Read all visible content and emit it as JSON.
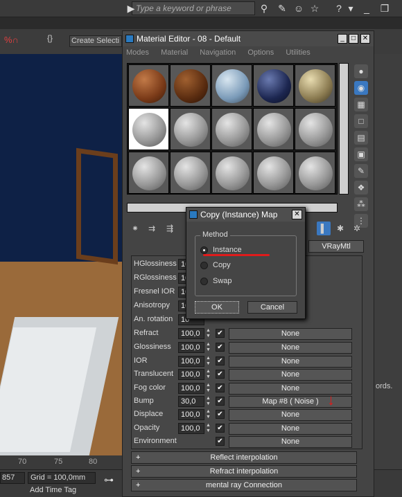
{
  "app": {
    "search_placeholder": "Type a keyword or phrase",
    "create_selection": "Create Selecti",
    "ruler_tick_70": "70",
    "ruler_tick_75": "75",
    "ruler_tick_80": "80",
    "coord_partial": "857",
    "grid": "Grid = 100,0mm",
    "add_time_tag": "Add Time Tag",
    "right_words": "ords."
  },
  "material_editor": {
    "title": "Material Editor - 08 - Default",
    "menu": [
      "Modes",
      "Material",
      "Navigation",
      "Options",
      "Utilities"
    ],
    "material_type_button": "VRayMtl",
    "params": [
      {
        "label": "HGlossiness",
        "value": "10"
      },
      {
        "label": "RGlossiness",
        "value": "10"
      },
      {
        "label": "Fresnel IOR",
        "value": "10"
      },
      {
        "label": "Anisotropy",
        "value": "10"
      },
      {
        "label": "An. rotation",
        "value": "10"
      },
      {
        "label": "Refract",
        "value": "100,0",
        "map": "None"
      },
      {
        "label": "Glossiness",
        "value": "100,0",
        "map": "None"
      },
      {
        "label": "IOR",
        "value": "100,0",
        "map": "None"
      },
      {
        "label": "Translucent",
        "value": "100,0",
        "map": "None"
      },
      {
        "label": "Fog color",
        "value": "100,0",
        "map": "None"
      },
      {
        "label": "Bump",
        "value": "30,0",
        "map": "Map #8  ( Noise )"
      },
      {
        "label": "Displace",
        "value": "100,0",
        "map": "None"
      },
      {
        "label": "Opacity",
        "value": "100,0",
        "map": "None"
      },
      {
        "label": "Environment",
        "value": "",
        "map": "None"
      }
    ],
    "rollouts": [
      "Reflect interpolation",
      "Refract interpolation",
      "mental ray Connection"
    ]
  },
  "dialog": {
    "title": "Copy (Instance) Map",
    "group_label": "Method",
    "options": [
      "Instance",
      "Copy",
      "Swap"
    ],
    "selected": "Instance",
    "ok_label": "OK",
    "cancel_label": "Cancel"
  },
  "colors": {
    "annotation_red": "#e01b1b",
    "viewport_blue": "#0e2146"
  }
}
